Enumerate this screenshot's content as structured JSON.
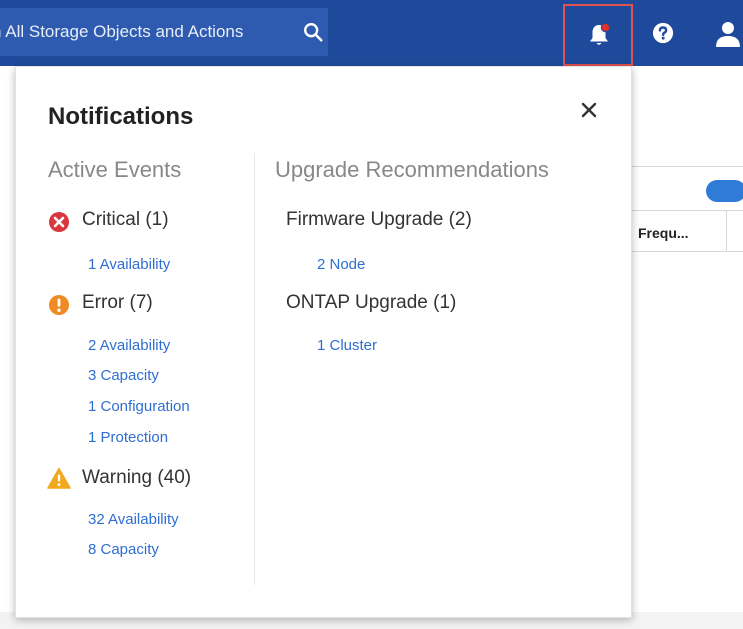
{
  "header": {
    "search_placeholder": "h All Storage Objects and Actions",
    "icons": [
      "search-icon",
      "bell-icon",
      "help-icon",
      "user-icon"
    ]
  },
  "background": {
    "column_header": "Frequ..."
  },
  "notifications": {
    "title": "Notifications",
    "active_events": {
      "heading": "Active Events",
      "groups": [
        {
          "label": "Critical (1)",
          "severity": "critical",
          "color": "#d9363e",
          "items": [
            "1 Availability"
          ]
        },
        {
          "label": "Error (7)",
          "severity": "error",
          "color": "#f08a24",
          "items": [
            "2 Availability",
            "3 Capacity",
            "1 Configuration",
            "1 Protection"
          ]
        },
        {
          "label": "Warning (40)",
          "severity": "warning",
          "color": "#f2a81d",
          "items": [
            "32 Availability",
            "8 Capacity"
          ]
        }
      ]
    },
    "upgrade_recommendations": {
      "heading": "Upgrade Recommendations",
      "groups": [
        {
          "label": "Firmware Upgrade (2)",
          "items": [
            "2 Node"
          ]
        },
        {
          "label": "ONTAP Upgrade (1)",
          "items": [
            "1 Cluster"
          ]
        }
      ]
    }
  },
  "colors": {
    "topbar": "#1f4a9c",
    "search": "#2e5bb0",
    "link": "#2f6ed1",
    "highlight": "#e0534f"
  }
}
